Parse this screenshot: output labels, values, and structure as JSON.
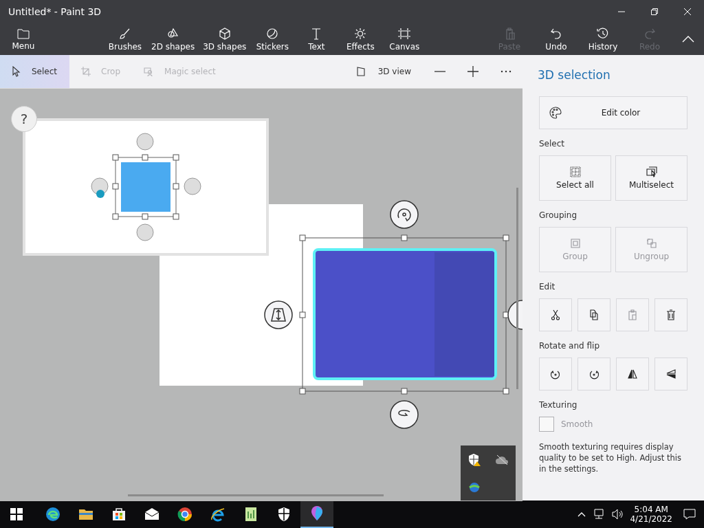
{
  "window": {
    "title": "Untitled* - Paint 3D"
  },
  "menu": {
    "label": "Menu"
  },
  "tools": [
    {
      "label": "Brushes",
      "kind": "brush"
    },
    {
      "label": "2D shapes",
      "kind": "shapes2d"
    },
    {
      "label": "3D shapes",
      "kind": "shapes3d"
    },
    {
      "label": "Stickers",
      "kind": "sticker"
    },
    {
      "label": "Text",
      "kind": "text"
    },
    {
      "label": "Effects",
      "kind": "effects"
    },
    {
      "label": "Canvas",
      "kind": "canvas"
    }
  ],
  "actions": [
    {
      "label": "Paste",
      "kind": "paste",
      "disabled": true
    },
    {
      "label": "Undo",
      "kind": "undo",
      "disabled": false
    },
    {
      "label": "History",
      "kind": "history",
      "disabled": false
    },
    {
      "label": "Redo",
      "kind": "redo",
      "disabled": true
    }
  ],
  "subtools": [
    {
      "label": "Select",
      "kind": "select",
      "selected": true,
      "disabled": false
    },
    {
      "label": "Crop",
      "kind": "crop",
      "selected": false,
      "disabled": true
    },
    {
      "label": "Magic select",
      "kind": "magic",
      "selected": false,
      "disabled": true
    }
  ],
  "view": {
    "label": "3D view"
  },
  "panel": {
    "title": "3D selection",
    "edit_color": "Edit color",
    "select": {
      "heading": "Select",
      "buttons": [
        {
          "label": "Select all",
          "kind": "selectall",
          "disabled": false
        },
        {
          "label": "Multiselect",
          "kind": "multi",
          "disabled": false
        }
      ]
    },
    "grouping": {
      "heading": "Grouping",
      "buttons": [
        {
          "label": "Group",
          "kind": "group",
          "disabled": true
        },
        {
          "label": "Ungroup",
          "kind": "ungroup",
          "disabled": true
        }
      ]
    },
    "edit": {
      "heading": "Edit",
      "buttons": [
        {
          "kind": "cut",
          "disabled": false
        },
        {
          "kind": "copy",
          "disabled": false
        },
        {
          "kind": "paste",
          "disabled": true
        },
        {
          "kind": "delete",
          "disabled": false
        }
      ]
    },
    "rotate": {
      "heading": "Rotate and flip",
      "buttons": [
        {
          "kind": "rotl"
        },
        {
          "kind": "rotr"
        },
        {
          "kind": "fliph"
        },
        {
          "kind": "flipv"
        }
      ]
    },
    "texturing": {
      "heading": "Texturing",
      "smooth": {
        "label": "Smooth",
        "checked": false,
        "disabled": true
      },
      "note": "Smooth texturing requires display quality to be set to High. Adjust this in the settings."
    }
  },
  "canvas": {
    "help": "?"
  },
  "taskbar": {
    "apps": [
      {
        "kind": "edge",
        "selected": false
      },
      {
        "kind": "folder",
        "selected": false
      },
      {
        "kind": "store",
        "selected": false
      },
      {
        "kind": "mail",
        "selected": false
      },
      {
        "kind": "chrome",
        "selected": false
      },
      {
        "kind": "ie",
        "selected": false
      },
      {
        "kind": "notepad",
        "selected": false
      },
      {
        "kind": "shield",
        "selected": false
      },
      {
        "kind": "paint3d",
        "selected": true
      }
    ],
    "time": "5:04 AM",
    "date": "4/21/2022"
  }
}
